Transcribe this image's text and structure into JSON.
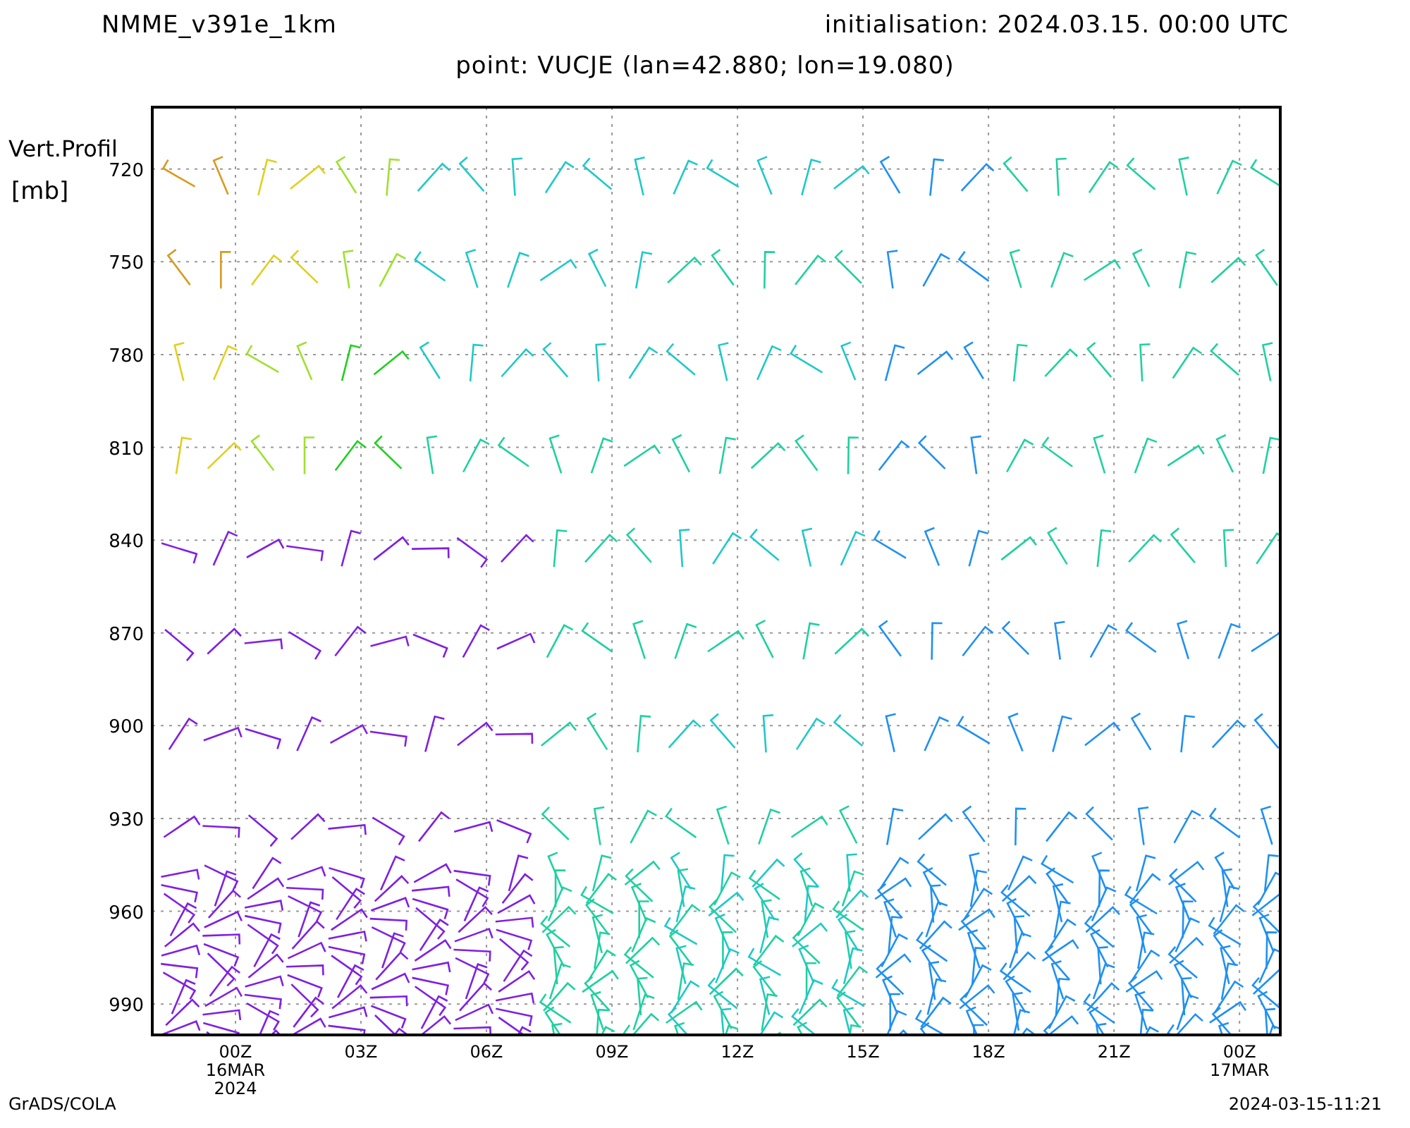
{
  "header": {
    "model": "NMME_v391e_1km",
    "initialisation": "initialisation: 2024.03.15. 00:00 UTC"
  },
  "subtitle": "point: VUCJE (lan=42.880; lon=19.080)",
  "plot": {
    "y_title": [
      "Vert.Profil",
      "[mb]"
    ],
    "y_labels": [
      "720",
      "750",
      "780",
      "810",
      "840",
      "870",
      "900",
      "930",
      "960",
      "990"
    ],
    "x_labels": [
      [
        "00Z",
        "16MAR",
        "2024"
      ],
      [
        "03Z"
      ],
      [
        "06Z"
      ],
      [
        "09Z"
      ],
      [
        "12Z"
      ],
      [
        "15Z"
      ],
      [
        "18Z"
      ],
      [
        "21Z"
      ],
      [
        "00Z",
        "17MAR"
      ]
    ]
  },
  "footer": {
    "left": "GrADS/COLA",
    "right": "2024-03-15-11:21"
  }
}
